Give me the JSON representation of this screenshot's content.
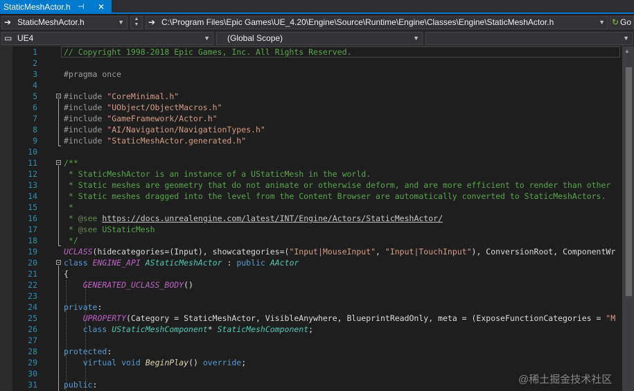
{
  "tab": {
    "label": "StaticMeshActor.h",
    "pin_glyph": "⊣",
    "close_glyph": "✕"
  },
  "nav": {
    "file_combo": "StaticMeshActor.h",
    "path_combo": "C:\\Program Files\\Epic Games\\UE_4.20\\Engine\\Source\\Runtime\\Engine\\Classes\\Engine\\StaticMeshActor.h",
    "go_label": "Go",
    "project_combo": "UE4",
    "scope_combo": "(Global Scope)",
    "member_combo": ""
  },
  "icons": {
    "nav_arrow": "arrow-right-icon",
    "go": "go-arrow-icon",
    "dropdown": "chevron-down-icon"
  },
  "colors": {
    "accent": "#007acc",
    "editor_bg": "#1e1e1e",
    "line_number": "#2b91af",
    "comment": "#57a64a",
    "keyword": "#569cd6",
    "string": "#d69d85",
    "type": "#4ec9b0",
    "macro": "#bd63c5"
  },
  "editor": {
    "line_numbers": [
      "1",
      "2",
      "3",
      "4",
      "5",
      "6",
      "7",
      "8",
      "9",
      "10",
      "11",
      "12",
      "13",
      "14",
      "15",
      "16",
      "17",
      "18",
      "19",
      "20",
      "21",
      "22",
      "23",
      "24",
      "25",
      "26",
      "27",
      "28",
      "29",
      "30",
      "31"
    ],
    "lines": [
      [
        [
          "c-com",
          "// Copyright 1998-2018 Epic Games, Inc. All Rights Reserved."
        ]
      ],
      [],
      [
        [
          "c-pp",
          "#pragma once"
        ]
      ],
      [],
      [
        [
          "c-pp",
          "#include "
        ],
        [
          "c-str",
          "\"CoreMinimal.h\""
        ]
      ],
      [
        [
          "c-pp",
          "#include "
        ],
        [
          "c-str",
          "\"UObject/ObjectMacros.h\""
        ]
      ],
      [
        [
          "c-pp",
          "#include "
        ],
        [
          "c-str",
          "\"GameFramework/Actor.h\""
        ]
      ],
      [
        [
          "c-pp",
          "#include "
        ],
        [
          "c-str",
          "\"AI/Navigation/NavigationTypes.h\""
        ]
      ],
      [
        [
          "c-pp",
          "#include "
        ],
        [
          "c-str",
          "\"StaticMeshActor.generated.h\""
        ]
      ],
      [],
      [
        [
          "c-com",
          "/**"
        ]
      ],
      [
        [
          "c-com",
          " * StaticMeshActor is an instance of a UStaticMesh in the world."
        ]
      ],
      [
        [
          "c-com",
          " * Static meshes are geometry that do not animate or otherwise deform, and are more efficient to render than other"
        ]
      ],
      [
        [
          "c-com",
          " * Static meshes dragged into the level from the Content Browser are automatically converted to StaticMeshActors."
        ]
      ],
      [
        [
          "c-com",
          " *"
        ]
      ],
      [
        [
          "c-com",
          " * "
        ],
        [
          "c-docc",
          "@see"
        ],
        [
          "c-com",
          " "
        ],
        [
          "c-link",
          "https://docs.unrealengine.com/latest/INT/Engine/Actors/StaticMeshActor/"
        ]
      ],
      [
        [
          "c-com",
          " * "
        ],
        [
          "c-docc",
          "@see"
        ],
        [
          "c-com",
          " UStaticMesh"
        ]
      ],
      [
        [
          "c-com",
          " */"
        ]
      ],
      [
        [
          "c-mac c-it",
          "UCLASS"
        ],
        [
          "",
          "(hidecategories=(Input), showcategories=("
        ],
        [
          "c-str",
          "\"Input|MouseInput\""
        ],
        [
          "",
          ", "
        ],
        [
          "c-str",
          "\"Input|TouchInput\""
        ],
        [
          "",
          "), ConversionRoot, ComponentWr"
        ]
      ],
      [
        [
          "c-kw",
          "class"
        ],
        [
          "",
          " "
        ],
        [
          "c-mac c-it",
          "ENGINE_API"
        ],
        [
          "",
          " "
        ],
        [
          "c-type c-it",
          "AStaticMeshActor"
        ],
        [
          "",
          " : "
        ],
        [
          "c-kw",
          "public"
        ],
        [
          "",
          " "
        ],
        [
          "c-type c-it",
          "AActor"
        ]
      ],
      [
        [
          "",
          "{"
        ]
      ],
      [
        [
          "",
          "    "
        ],
        [
          "c-mac c-it",
          "GENERATED_UCLASS_BODY"
        ],
        [
          "",
          "()"
        ]
      ],
      [],
      [
        [
          "c-kw",
          "private"
        ],
        [
          "",
          ":"
        ]
      ],
      [
        [
          "",
          "    "
        ],
        [
          "c-mac c-it",
          "UPROPERTY"
        ],
        [
          "",
          "(Category = StaticMeshActor, VisibleAnywhere, BlueprintReadOnly, meta = (ExposeFunctionCategories = "
        ],
        [
          "c-str",
          "\"M"
        ]
      ],
      [
        [
          "",
          "    "
        ],
        [
          "c-kw",
          "class"
        ],
        [
          "",
          " "
        ],
        [
          "c-type c-it",
          "UStaticMeshComponent"
        ],
        [
          "",
          "* "
        ],
        [
          "c-type c-it",
          "StaticMeshComponent"
        ],
        [
          "",
          ";"
        ]
      ],
      [],
      [
        [
          "c-kw",
          "protected"
        ],
        [
          "",
          ":"
        ]
      ],
      [
        [
          "",
          "    "
        ],
        [
          "c-kw",
          "virtual"
        ],
        [
          "",
          " "
        ],
        [
          "c-kw",
          "void"
        ],
        [
          "",
          " "
        ],
        [
          "c-fn c-it",
          "BeginPlay"
        ],
        [
          "",
          "() "
        ],
        [
          "c-kw",
          "override"
        ],
        [
          "",
          ";"
        ]
      ],
      [],
      [
        [
          "c-kw",
          "public"
        ],
        [
          "",
          ":"
        ]
      ]
    ]
  },
  "watermark": "@稀土掘金技术社区"
}
